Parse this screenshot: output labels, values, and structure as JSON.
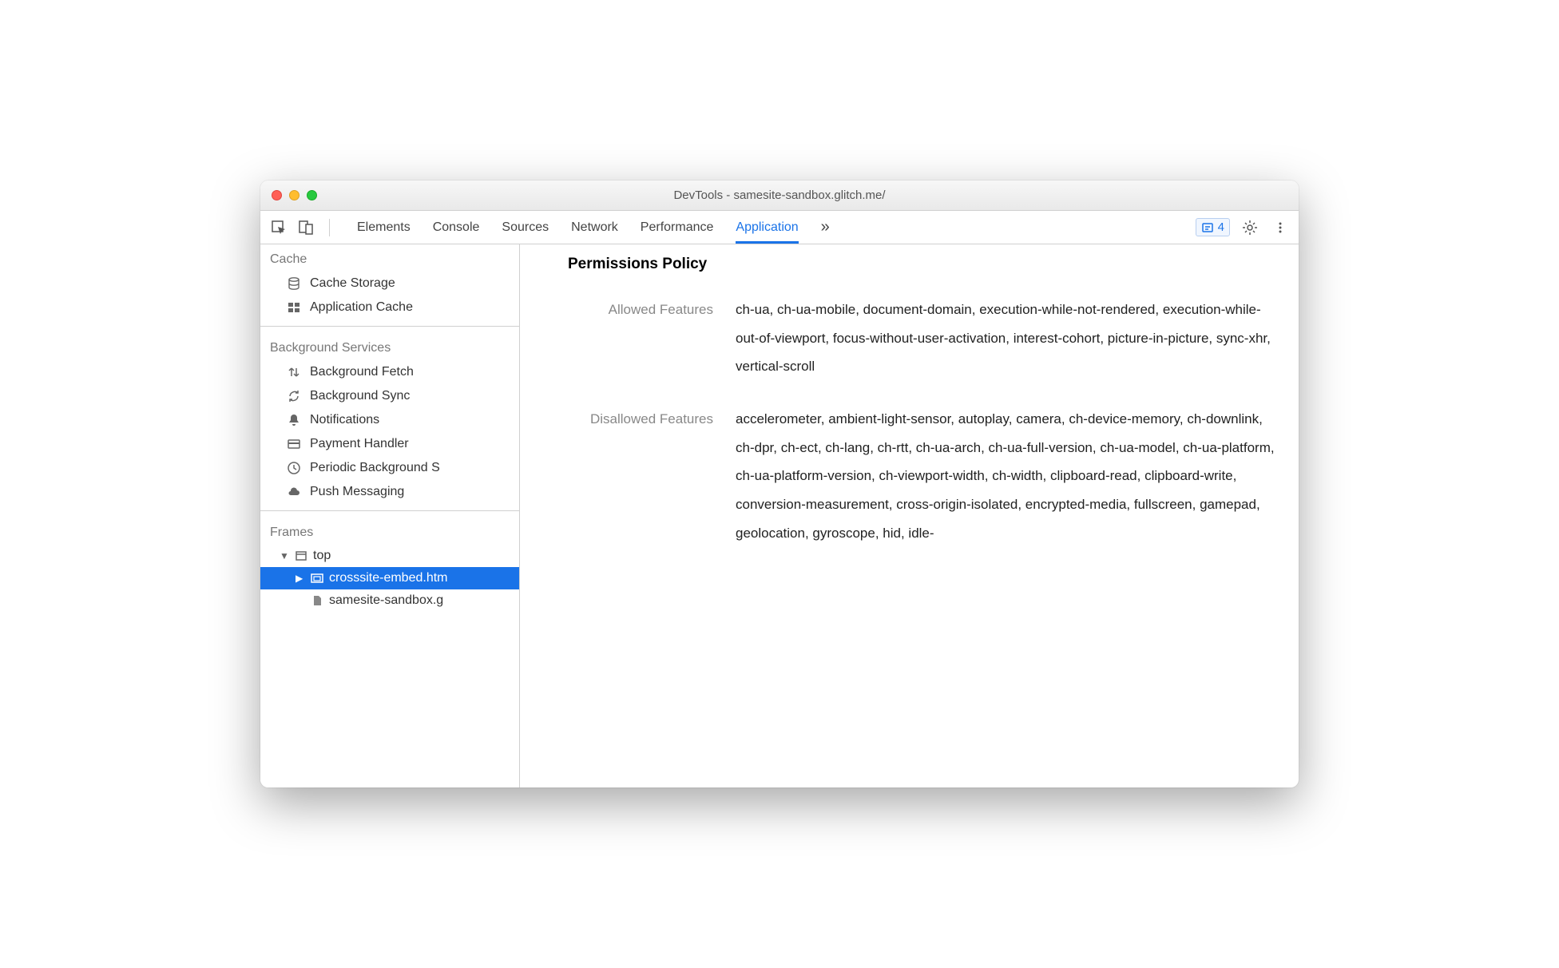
{
  "window": {
    "title": "DevTools - samesite-sandbox.glitch.me/"
  },
  "tabs": {
    "items": [
      "Elements",
      "Console",
      "Sources",
      "Network",
      "Performance",
      "Application"
    ],
    "active": "Application",
    "more": "»"
  },
  "toolbar": {
    "issues_count": "4"
  },
  "sidebar": {
    "cache": {
      "title": "Cache",
      "items": [
        "Cache Storage",
        "Application Cache"
      ]
    },
    "background": {
      "title": "Background Services",
      "items": [
        "Background Fetch",
        "Background Sync",
        "Notifications",
        "Payment Handler",
        "Periodic Background S",
        "Push Messaging"
      ]
    },
    "frames": {
      "title": "Frames",
      "top": "top",
      "embed": "crosssite-embed.htm",
      "sandbox": "samesite-sandbox.g"
    }
  },
  "content": {
    "heading": "Permissions Policy",
    "allowed_label": "Allowed Features",
    "allowed_value": "ch-ua, ch-ua-mobile, document-domain, execution-while-not-rendered, execution-while-out-of-viewport, focus-without-user-activation, interest-cohort, picture-in-picture, sync-xhr, vertical-scroll",
    "disallowed_label": "Disallowed Features",
    "disallowed_value": "accelerometer, ambient-light-sensor, autoplay, camera, ch-device-memory, ch-downlink, ch-dpr, ch-ect, ch-lang, ch-rtt, ch-ua-arch, ch-ua-full-version, ch-ua-model, ch-ua-platform, ch-ua-platform-version, ch-viewport-width, ch-width, clipboard-read, clipboard-write, conversion-measurement, cross-origin-isolated, encrypted-media, fullscreen, gamepad, geolocation, gyroscope, hid, idle-"
  }
}
